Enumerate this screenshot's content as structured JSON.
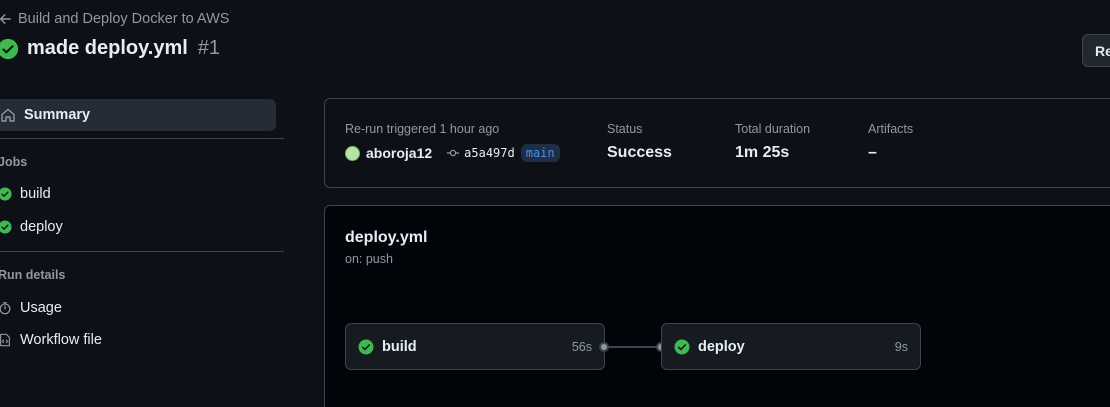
{
  "header": {
    "back_label": "Build and Deploy Docker to AWS",
    "run_title": "made deploy.yml",
    "run_number": "#1",
    "rerun_button_label": "Re"
  },
  "sidebar": {
    "summary_label": "Summary",
    "jobs_heading": "Jobs",
    "jobs": [
      {
        "label": "build"
      },
      {
        "label": "deploy"
      }
    ],
    "run_details_heading": "Run details",
    "details": [
      {
        "label": "Usage"
      },
      {
        "label": "Workflow file"
      }
    ]
  },
  "summary": {
    "trigger_label": "Re-run triggered 1 hour ago",
    "actor": "aboroja12",
    "commit": "a5a497d",
    "branch": "main",
    "status_label": "Status",
    "status_value": "Success",
    "duration_label": "Total duration",
    "duration_value": "1m 25s",
    "artifacts_label": "Artifacts",
    "artifacts_value": "–"
  },
  "workflow": {
    "name": "deploy.yml",
    "trigger": "on: push",
    "jobs": [
      {
        "name": "build",
        "duration": "56s"
      },
      {
        "name": "deploy",
        "duration": "9s"
      }
    ]
  },
  "colors": {
    "success": "#3fb950",
    "background": "#0d1117",
    "link": "#4493f8"
  }
}
